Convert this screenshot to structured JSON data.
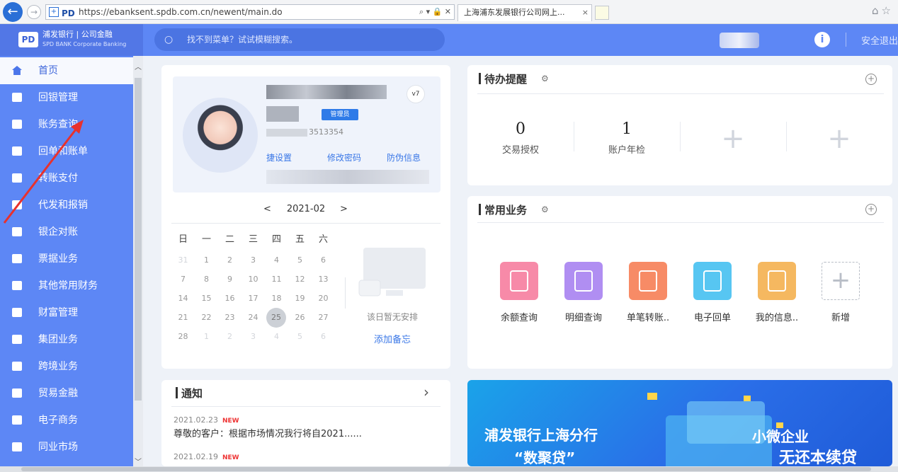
{
  "browser": {
    "url": "https://ebanksent.spdb.com.cn/newent/main.do",
    "tab_title": "上海浦东发展银行公司网上...",
    "tab_close": "×",
    "address_tools": "⌕ ▾ 🔒 ✕"
  },
  "header": {
    "logo_mark": "PD",
    "logo_name": "浦发银行 | 公司金融",
    "logo_sub": "SPD BANK  Corporate Banking",
    "search_placeholder": "找不到菜单？试试模糊搜索。",
    "info_label": "i",
    "logout_label": "安全退出"
  },
  "sidebar": {
    "items": [
      {
        "label": "首页",
        "icon": "home-icon"
      },
      {
        "label": "回银管理",
        "icon": "monitor-icon"
      },
      {
        "label": "账务查询",
        "icon": "document-search-icon"
      },
      {
        "label": "回单和账单",
        "icon": "receipt-icon"
      },
      {
        "label": "转账支付",
        "icon": "transfer-icon"
      },
      {
        "label": "代发和报销",
        "icon": "payroll-icon"
      },
      {
        "label": "银企对账",
        "icon": "reconcile-icon"
      },
      {
        "label": "票据业务",
        "icon": "bill-icon"
      },
      {
        "label": "其他常用财务",
        "icon": "grid-icon"
      },
      {
        "label": "财富管理",
        "icon": "wealth-icon"
      },
      {
        "label": "集团业务",
        "icon": "group-icon"
      },
      {
        "label": "跨境业务",
        "icon": "crossborder-icon"
      },
      {
        "label": "贸易金融",
        "icon": "trade-icon"
      },
      {
        "label": "电子商务",
        "icon": "cart-icon"
      },
      {
        "label": "同业市场",
        "icon": "heart-icon"
      }
    ]
  },
  "profile": {
    "role_badge": "管理员",
    "level_badge": "v7",
    "account_tail": "3513354",
    "links": [
      "捷设置",
      "修改密码",
      "防伪信息"
    ]
  },
  "calendar": {
    "month": "2021-02",
    "prev": "<",
    "next": ">",
    "weekdays": [
      "日",
      "一",
      "二",
      "三",
      "四",
      "五",
      "六"
    ],
    "weeks": [
      [
        "31",
        "1",
        "2",
        "3",
        "4",
        "5",
        "6"
      ],
      [
        "7",
        "8",
        "9",
        "10",
        "11",
        "12",
        "13"
      ],
      [
        "14",
        "15",
        "16",
        "17",
        "18",
        "19",
        "20"
      ],
      [
        "21",
        "22",
        "23",
        "24",
        "25",
        "26",
        "27"
      ],
      [
        "28",
        "1",
        "2",
        "3",
        "4",
        "5",
        "6"
      ]
    ],
    "today": "25",
    "empty_text": "该日暂无安排",
    "add_memo": "添加备忘"
  },
  "todo": {
    "title": "待办提醒",
    "items": [
      {
        "count": "0",
        "label": "交易授权"
      },
      {
        "count": "1",
        "label": "账户年检"
      }
    ],
    "add_symbol": "+"
  },
  "common_business": {
    "title": "常用业务",
    "items": [
      {
        "label": "余额查询",
        "color": "#f78aa8",
        "icon": "balance-icon"
      },
      {
        "label": "明细查询",
        "color": "#b08ef2",
        "icon": "detail-icon"
      },
      {
        "label": "单笔转账..",
        "color": "#f78b66",
        "icon": "transfer-icon"
      },
      {
        "label": "电子回单",
        "color": "#57c6f2",
        "icon": "receipt-icon"
      },
      {
        "label": "我的信息..",
        "color": "#f5b860",
        "icon": "chart-icon"
      }
    ],
    "add_label": "新增"
  },
  "notice": {
    "title": "通知",
    "more": "›",
    "items": [
      {
        "date": "2021.02.23",
        "tag": "NEW",
        "text": "尊敬的客户：根据市场情况我行将自2021......"
      },
      {
        "date": "2021.02.19",
        "tag": "NEW",
        "text": "…"
      }
    ]
  },
  "banner": {
    "line1": "浦发银行上海分行",
    "line2": "“数聚贷”",
    "line3": "小微企业",
    "line4": "无还本续贷"
  },
  "colors": {
    "brand": "#5d87f5",
    "link": "#3b78e7",
    "annotation_arrow": "#e8312d"
  }
}
